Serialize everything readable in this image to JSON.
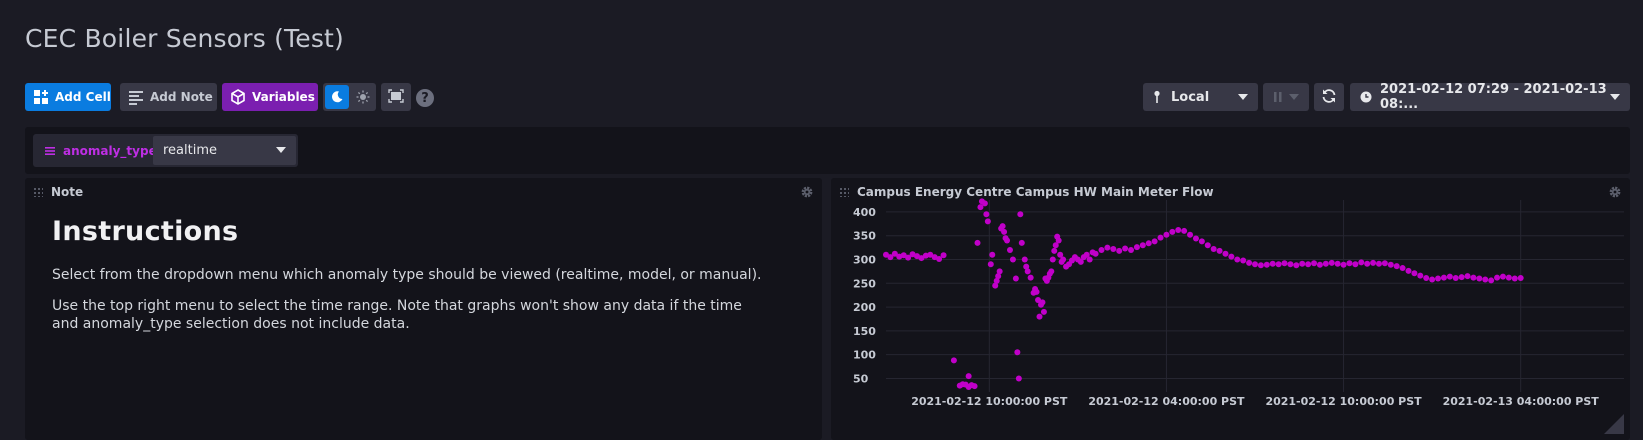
{
  "dashboard": {
    "title": "CEC Boiler Sensors (Test)"
  },
  "toolbar": {
    "add_cell_label": "Add Cell",
    "add_note_label": "Add Note",
    "variables_label": "Variables",
    "timezone_value": "Local",
    "time_range_value": "2021-02-12 07:29 - 2021-02-13 08:..."
  },
  "variables": [
    {
      "name": "anomaly_type",
      "selected": "realtime"
    }
  ],
  "note_cell": {
    "title": "Note",
    "heading": "Instructions",
    "paragraph1": "Select from the dropdown menu which anomaly type should be viewed (realtime, model, or manual).",
    "paragraph2": "Use the top right menu to select the time range. Note that graphs won't show any data if the time and anomaly_type selection does not include data."
  },
  "graph_cell": {
    "title": "Campus Energy Centre Campus HW Main Meter Flow"
  },
  "chart_data": {
    "type": "scatter",
    "title": "Campus Energy Centre Campus HW Main Meter Flow",
    "y_ticks": [
      "400",
      "350",
      "300",
      "250",
      "200",
      "150",
      "100",
      "50"
    ],
    "x_ticks": [
      "2021-02-12 10:00:00 PST",
      "2021-02-12 04:00:00 PST",
      "2021-02-12 10:00:00 PST",
      "2021-02-13 04:00:00 PST"
    ],
    "ylim": [
      30,
      425
    ],
    "xlim": [
      0,
      25
    ],
    "grid": true,
    "color": "#c100c9",
    "series": [
      {
        "points": [
          [
            0.0,
            310
          ],
          [
            0.15,
            305
          ],
          [
            0.3,
            312
          ],
          [
            0.45,
            306
          ],
          [
            0.6,
            309
          ],
          [
            0.75,
            304
          ],
          [
            0.9,
            311
          ],
          [
            1.05,
            307
          ],
          [
            1.2,
            303
          ],
          [
            1.35,
            308
          ],
          [
            1.5,
            310
          ],
          [
            1.65,
            305
          ],
          [
            1.8,
            301
          ],
          [
            1.95,
            309
          ],
          [
            2.3,
            88
          ],
          [
            2.5,
            35
          ],
          [
            2.6,
            38
          ],
          [
            2.7,
            37
          ],
          [
            2.8,
            32
          ],
          [
            2.9,
            36
          ],
          [
            3.0,
            34
          ],
          [
            2.8,
            55
          ],
          [
            3.1,
            335
          ],
          [
            3.2,
            410
          ],
          [
            3.25,
            422
          ],
          [
            3.35,
            418
          ],
          [
            3.4,
            395
          ],
          [
            3.45,
            380
          ],
          [
            3.55,
            290
          ],
          [
            3.6,
            310
          ],
          [
            3.7,
            245
          ],
          [
            3.75,
            255
          ],
          [
            3.8,
            265
          ],
          [
            3.85,
            275
          ],
          [
            3.9,
            365
          ],
          [
            3.95,
            370
          ],
          [
            4.0,
            358
          ],
          [
            4.05,
            345
          ],
          [
            4.1,
            340
          ],
          [
            4.2,
            320
          ],
          [
            4.3,
            300
          ],
          [
            4.4,
            260
          ],
          [
            4.45,
            105
          ],
          [
            4.5,
            50
          ],
          [
            4.55,
            395
          ],
          [
            4.6,
            335
          ],
          [
            4.7,
            300
          ],
          [
            4.75,
            285
          ],
          [
            4.8,
            275
          ],
          [
            4.9,
            262
          ],
          [
            5.0,
            230
          ],
          [
            5.05,
            238
          ],
          [
            5.1,
            232
          ],
          [
            5.15,
            215
          ],
          [
            5.2,
            180
          ],
          [
            5.25,
            205
          ],
          [
            5.3,
            210
          ],
          [
            5.35,
            190
          ],
          [
            5.4,
            260
          ],
          [
            5.45,
            255
          ],
          [
            5.5,
            262
          ],
          [
            5.55,
            270
          ],
          [
            5.6,
            275
          ],
          [
            5.65,
            300
          ],
          [
            5.7,
            318
          ],
          [
            5.75,
            330
          ],
          [
            5.8,
            348
          ],
          [
            5.85,
            340
          ],
          [
            5.9,
            310
          ],
          [
            5.95,
            295
          ],
          [
            6.0,
            300
          ],
          [
            6.1,
            285
          ],
          [
            6.2,
            290
          ],
          [
            6.3,
            298
          ],
          [
            6.4,
            305
          ],
          [
            6.5,
            300
          ],
          [
            6.6,
            295
          ],
          [
            6.7,
            305
          ],
          [
            6.8,
            310
          ],
          [
            6.9,
            300
          ],
          [
            7.0,
            315
          ],
          [
            7.1,
            312
          ],
          [
            7.3,
            320
          ],
          [
            7.5,
            325
          ],
          [
            7.7,
            322
          ],
          [
            7.9,
            318
          ],
          [
            8.1,
            323
          ],
          [
            8.3,
            320
          ],
          [
            8.5,
            326
          ],
          [
            8.7,
            330
          ],
          [
            8.9,
            334
          ],
          [
            9.1,
            338
          ],
          [
            9.3,
            346
          ],
          [
            9.5,
            352
          ],
          [
            9.7,
            358
          ],
          [
            9.9,
            362
          ],
          [
            10.1,
            360
          ],
          [
            10.3,
            352
          ],
          [
            10.5,
            344
          ],
          [
            10.7,
            338
          ],
          [
            10.9,
            330
          ],
          [
            11.1,
            322
          ],
          [
            11.3,
            318
          ],
          [
            11.5,
            312
          ],
          [
            11.7,
            306
          ],
          [
            11.9,
            300
          ],
          [
            12.1,
            298
          ],
          [
            12.3,
            293
          ],
          [
            12.5,
            290
          ],
          [
            12.7,
            288
          ],
          [
            12.9,
            289
          ],
          [
            13.1,
            291
          ],
          [
            13.3,
            290
          ],
          [
            13.5,
            292
          ],
          [
            13.7,
            290
          ],
          [
            13.9,
            288
          ],
          [
            14.1,
            291
          ],
          [
            14.3,
            290
          ],
          [
            14.5,
            292
          ],
          [
            14.7,
            289
          ],
          [
            14.9,
            291
          ],
          [
            15.1,
            293
          ],
          [
            15.3,
            291
          ],
          [
            15.5,
            289
          ],
          [
            15.7,
            292
          ],
          [
            15.9,
            290
          ],
          [
            16.1,
            294
          ],
          [
            16.3,
            291
          ],
          [
            16.5,
            293
          ],
          [
            16.7,
            291
          ],
          [
            16.9,
            292
          ],
          [
            17.1,
            289
          ],
          [
            17.3,
            286
          ],
          [
            17.5,
            282
          ],
          [
            17.7,
            276
          ],
          [
            17.9,
            271
          ],
          [
            18.1,
            266
          ],
          [
            18.3,
            261
          ],
          [
            18.5,
            258
          ],
          [
            18.7,
            260
          ],
          [
            18.9,
            262
          ],
          [
            19.1,
            264
          ],
          [
            19.3,
            261
          ],
          [
            19.5,
            263
          ],
          [
            19.7,
            265
          ],
          [
            19.9,
            262
          ],
          [
            20.1,
            260
          ],
          [
            20.3,
            258
          ],
          [
            20.5,
            256
          ],
          [
            20.7,
            262
          ],
          [
            20.9,
            264
          ],
          [
            21.1,
            262
          ],
          [
            21.3,
            260
          ],
          [
            21.5,
            261
          ]
        ]
      }
    ]
  }
}
